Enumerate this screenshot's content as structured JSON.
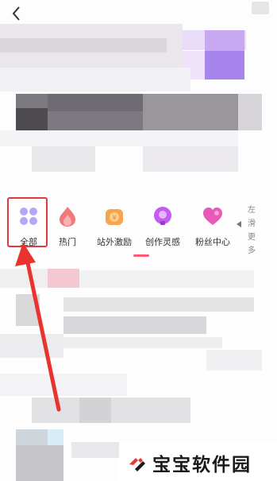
{
  "nav": {
    "back_icon": "chevron-left-icon"
  },
  "categories": [
    {
      "label": "全部",
      "icon": "grid-icon",
      "color": "#b7a6f5"
    },
    {
      "label": "热门",
      "icon": "flame-icon",
      "color": "#f07a7a"
    },
    {
      "label": "站外激励",
      "icon": "coin-bag-icon",
      "color": "#f7a44f"
    },
    {
      "label": "创作灵感",
      "icon": "lightbulb-icon",
      "color": "#c45cf0"
    },
    {
      "label": "粉丝中心",
      "icon": "heart-icon",
      "color": "#e85ab8"
    }
  ],
  "more_hint": [
    "左",
    "滑",
    "更",
    "多"
  ],
  "watermark": {
    "text": "宝宝软件园",
    "logo_color": "#e33a3a"
  },
  "colors": {
    "highlight": "#e23a3a",
    "indicator": "#ff5a7a"
  }
}
